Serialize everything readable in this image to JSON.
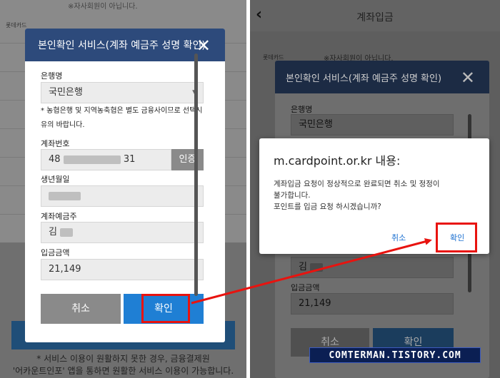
{
  "left": {
    "bg_notice_line1": "* 서비스 이용이 원활하지 못한 경우, 금융결제원",
    "bg_notice_line2": "'어카운트인포' 앱을 통하면 원활한 서비스 이용이 가능합니다.",
    "bg_top_text": "※자사회원이 아닙니다.",
    "bg_card_label": "롯데카드",
    "modal": {
      "title": "본인확인 서비스(계좌 예금주 성명 확인)",
      "bank_label": "은행명",
      "bank_value": "국민은행",
      "note": "* 농협은행 및 지역농축협은 별도 금융사이므로 선택시 유의 바랍니다.",
      "account_label": "계좌번호",
      "account_prefix": "48",
      "account_suffix": "31",
      "auth_button": "인증",
      "birth_label": "생년월일",
      "holder_label": "계좌예금주",
      "holder_value": "김",
      "amount_label": "입금금액",
      "amount_value": "21,149",
      "cancel_button": "취소",
      "ok_button": "확인"
    }
  },
  "right": {
    "page_title": "계좌입금",
    "bg_card_label": "롯데카드",
    "bg_top_text": "※자사회원이 아닙니다.",
    "modal": {
      "title": "본인확인 서비스(계좌 예금주 성명 확인)",
      "bank_label": "은행명",
      "bank_value": "국민은행",
      "holder_value": "김",
      "amount_label": "입금금액",
      "amount_value": "21,149",
      "cancel_button": "취소",
      "ok_button": "확인"
    },
    "alert": {
      "title": "m.cardpoint.or.kr 내용:",
      "message_line1": "계좌입금 요청이 정상적으로 완료되면 취소 및 정정이",
      "message_line2": "불가합니다.",
      "message_line3": "포인트를 입금 요청 하시겠습니까?",
      "cancel": "취소",
      "ok": "확인"
    }
  },
  "watermark": "COMTERMAN.TISTORY.COM",
  "colors": {
    "modal_header": "#2d4a7b",
    "ok_blue": "#1f7fd4",
    "highlight_red": "#e8130f",
    "link_blue": "#1a6fd0"
  }
}
